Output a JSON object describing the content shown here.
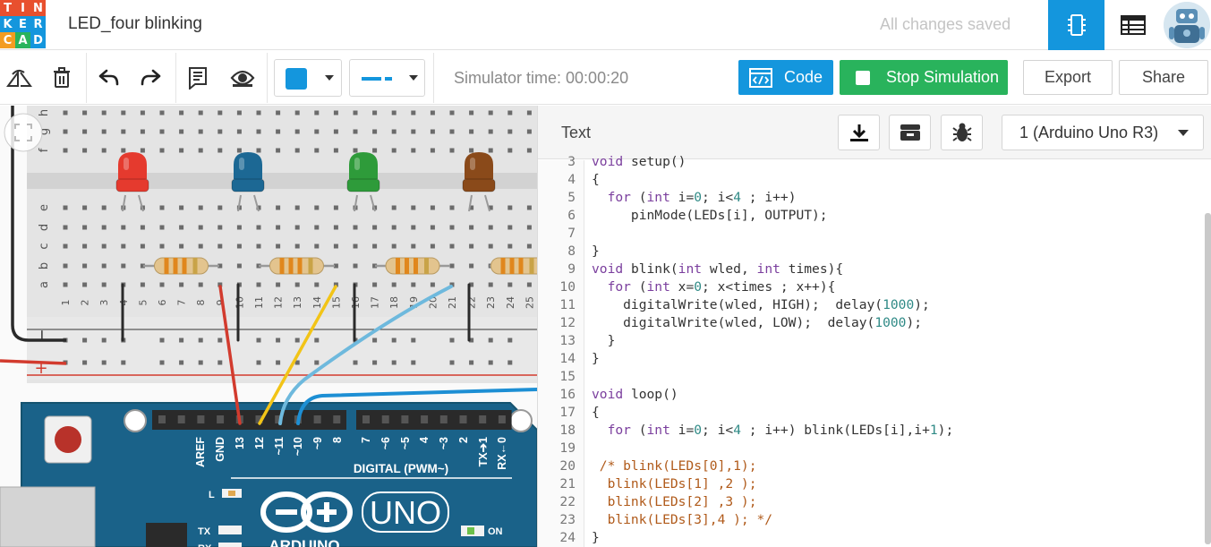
{
  "app": {
    "logo_letters": [
      "T",
      "I",
      "N",
      "K",
      "E",
      "R",
      "C",
      "A",
      "D"
    ],
    "logo_colors": [
      "#e8502e",
      "#e8502e",
      "#e8502e",
      "#1496dd",
      "#1496dd",
      "#1496dd",
      "#f39c21",
      "#29b35c",
      "#1496dd"
    ],
    "project_title": "LED_four blinking",
    "save_status": "All changes saved"
  },
  "toolbar": {
    "color_value": "#1496dd",
    "simulator_time": "Simulator time: 00:00:20",
    "code_label": "Code",
    "stop_label": "Stop Simulation",
    "export_label": "Export",
    "share_label": "Share"
  },
  "code_panel": {
    "mode": "Text",
    "device": "1 (Arduino Uno R3)",
    "lines": [
      {
        "n": "3",
        "segs": [
          [
            "kw",
            "void"
          ],
          [
            "t",
            " setup()"
          ]
        ]
      },
      {
        "n": "4",
        "segs": [
          [
            "t",
            "{"
          ]
        ]
      },
      {
        "n": "5",
        "segs": [
          [
            "t",
            "  "
          ],
          [
            "kw",
            "for"
          ],
          [
            "t",
            " ("
          ],
          [
            "kw",
            "int"
          ],
          [
            "t",
            " i="
          ],
          [
            "num",
            "0"
          ],
          [
            "t",
            "; i<"
          ],
          [
            "num",
            "4"
          ],
          [
            "t",
            " ; i++)"
          ]
        ]
      },
      {
        "n": "6",
        "segs": [
          [
            "t",
            "     pinMode(LEDs[i], OUTPUT);"
          ]
        ]
      },
      {
        "n": "7",
        "segs": []
      },
      {
        "n": "8",
        "segs": [
          [
            "t",
            "}"
          ]
        ]
      },
      {
        "n": "9",
        "segs": [
          [
            "kw",
            "void"
          ],
          [
            "t",
            " blink("
          ],
          [
            "kw",
            "int"
          ],
          [
            "t",
            " wled, "
          ],
          [
            "kw",
            "int"
          ],
          [
            "t",
            " times){"
          ]
        ]
      },
      {
        "n": "10",
        "segs": [
          [
            "t",
            "  "
          ],
          [
            "kw",
            "for"
          ],
          [
            "t",
            " ("
          ],
          [
            "kw",
            "int"
          ],
          [
            "t",
            " x="
          ],
          [
            "num",
            "0"
          ],
          [
            "t",
            "; x<times ; x++){"
          ]
        ]
      },
      {
        "n": "11",
        "segs": [
          [
            "t",
            "    digitalWrite(wled, HIGH);  delay("
          ],
          [
            "num",
            "1000"
          ],
          [
            "t",
            ");"
          ]
        ]
      },
      {
        "n": "12",
        "segs": [
          [
            "t",
            "    digitalWrite(wled, LOW);  delay("
          ],
          [
            "num",
            "1000"
          ],
          [
            "t",
            ");"
          ]
        ]
      },
      {
        "n": "13",
        "segs": [
          [
            "t",
            "  }"
          ]
        ]
      },
      {
        "n": "14",
        "segs": [
          [
            "t",
            "}"
          ]
        ]
      },
      {
        "n": "15",
        "segs": []
      },
      {
        "n": "16",
        "segs": [
          [
            "kw",
            "void"
          ],
          [
            "t",
            " loop()"
          ]
        ]
      },
      {
        "n": "17",
        "segs": [
          [
            "t",
            "{"
          ]
        ]
      },
      {
        "n": "18",
        "segs": [
          [
            "t",
            "  "
          ],
          [
            "kw",
            "for"
          ],
          [
            "t",
            " ("
          ],
          [
            "kw",
            "int"
          ],
          [
            "t",
            " i="
          ],
          [
            "num",
            "0"
          ],
          [
            "t",
            "; i<"
          ],
          [
            "num",
            "4"
          ],
          [
            "t",
            " ; i++) blink(LEDs[i],i+"
          ],
          [
            "num",
            "1"
          ],
          [
            "t",
            ");"
          ]
        ]
      },
      {
        "n": "19",
        "segs": []
      },
      {
        "n": "20",
        "segs": [
          [
            "cm",
            " /* blink(LEDs[0],1);"
          ]
        ]
      },
      {
        "n": "21",
        "segs": [
          [
            "cm",
            "  blink(LEDs[1] ,2 );"
          ]
        ]
      },
      {
        "n": "22",
        "segs": [
          [
            "cm",
            "  blink(LEDs[2] ,3 );"
          ]
        ]
      },
      {
        "n": "23",
        "segs": [
          [
            "cm",
            "  blink(LEDs[3],4 ); */"
          ]
        ]
      },
      {
        "n": "24",
        "segs": [
          [
            "t",
            "}"
          ]
        ]
      }
    ]
  },
  "circuit": {
    "led_colors": [
      "#e53a2e",
      "#1c6894",
      "#2e9b3a",
      "#8a4a1a"
    ],
    "breadboard_row_letters_top": [
      "f",
      "g",
      "h"
    ],
    "breadboard_row_letters_mid": [
      "e",
      "d",
      "c",
      "b",
      "a"
    ],
    "breadboard_columns": [
      "1",
      "2",
      "3",
      "4",
      "5",
      "6",
      "7",
      "8",
      "9",
      "10",
      "11",
      "12",
      "13",
      "14",
      "15",
      "16",
      "17",
      "18",
      "19",
      "20",
      "21",
      "22",
      "23",
      "24",
      "25"
    ],
    "rail_minus": "−",
    "rail_plus": "+",
    "pin_labels": [
      "AREF",
      "GND",
      "13",
      "12",
      "~11",
      "~10",
      "~9",
      "8",
      "7",
      "~6",
      "~5",
      "4",
      "~3",
      "2",
      "TX➔1",
      "RX←0"
    ],
    "digital_label": "DIGITAL (PWM~)",
    "board_name": "UNO",
    "board_brand": "ARDUINO",
    "indicator_labels": [
      "L",
      "TX",
      "RX",
      "ON"
    ]
  }
}
